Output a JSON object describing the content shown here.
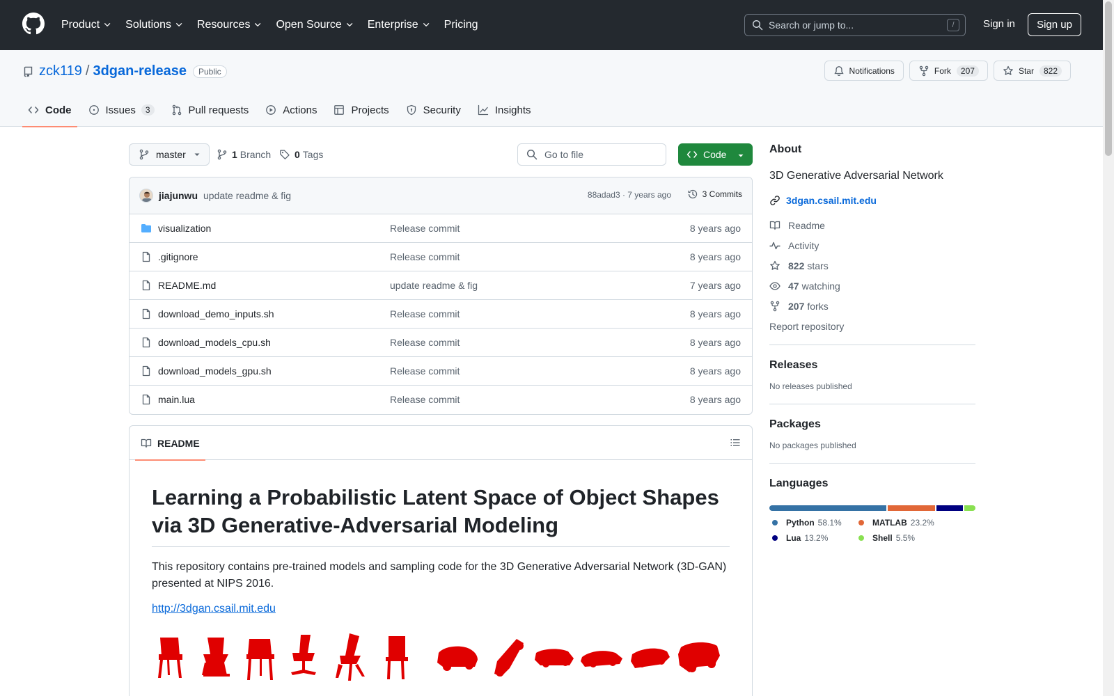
{
  "header": {
    "nav": [
      {
        "label": "Product",
        "has_menu": true
      },
      {
        "label": "Solutions",
        "has_menu": true
      },
      {
        "label": "Resources",
        "has_menu": true
      },
      {
        "label": "Open Source",
        "has_menu": true
      },
      {
        "label": "Enterprise",
        "has_menu": true
      },
      {
        "label": "Pricing",
        "has_menu": false
      }
    ],
    "search_placeholder": "Search or jump to...",
    "search_shortcut": "/",
    "sign_in": "Sign in",
    "sign_up": "Sign up"
  },
  "repo": {
    "owner": "zck119",
    "separator": "/",
    "name": "3dgan-release",
    "visibility": "Public",
    "notifications_label": "Notifications",
    "fork_label": "Fork",
    "fork_count": "207",
    "star_label": "Star",
    "star_count": "822"
  },
  "tabs": [
    {
      "label": "Code",
      "icon": "code-icon",
      "active": true,
      "counter": ""
    },
    {
      "label": "Issues",
      "icon": "issue-icon",
      "active": false,
      "counter": "3"
    },
    {
      "label": "Pull requests",
      "icon": "pull-request-icon",
      "active": false,
      "counter": ""
    },
    {
      "label": "Actions",
      "icon": "play-icon",
      "active": false,
      "counter": ""
    },
    {
      "label": "Projects",
      "icon": "table-icon",
      "active": false,
      "counter": ""
    },
    {
      "label": "Security",
      "icon": "shield-icon",
      "active": false,
      "counter": ""
    },
    {
      "label": "Insights",
      "icon": "graph-icon",
      "active": false,
      "counter": ""
    }
  ],
  "toolbar": {
    "branch": "master",
    "branch_count": "1",
    "branch_label": "Branch",
    "tag_count": "0",
    "tag_label": "Tags",
    "goto_placeholder": "Go to file",
    "code_button": "Code"
  },
  "latest_commit": {
    "author": "jiajunwu",
    "message": "update readme & fig",
    "meta": "88adad3 · 7 years ago",
    "commits": "3 Commits"
  },
  "files": [
    {
      "name": "visualization",
      "type": "folder",
      "message": "Release commit",
      "age": "8 years ago"
    },
    {
      "name": ".gitignore",
      "type": "file",
      "message": "Release commit",
      "age": "8 years ago"
    },
    {
      "name": "README.md",
      "type": "file",
      "message": "update readme & fig",
      "age": "7 years ago"
    },
    {
      "name": "download_demo_inputs.sh",
      "type": "file",
      "message": "Release commit",
      "age": "8 years ago"
    },
    {
      "name": "download_models_cpu.sh",
      "type": "file",
      "message": "Release commit",
      "age": "8 years ago"
    },
    {
      "name": "download_models_gpu.sh",
      "type": "file",
      "message": "Release commit",
      "age": "8 years ago"
    },
    {
      "name": "main.lua",
      "type": "file",
      "message": "Release commit",
      "age": "8 years ago"
    }
  ],
  "readme": {
    "tab_label": "README",
    "title": "Learning a Probabilistic Latent Space of Object Shapes via 3D Generative-Adversarial Modeling",
    "paragraph": "This repository contains pre-trained models and sampling code for the 3D Generative Adversarial Network (3D-GAN) presented at NIPS 2016.",
    "link": "http://3dgan.csail.mit.edu"
  },
  "about": {
    "heading": "About",
    "description": "3D Generative Adversarial Network",
    "homepage": "3dgan.csail.mit.edu",
    "readme": "Readme",
    "activity": "Activity",
    "stars_count": "822",
    "stars_label": "stars",
    "watching_count": "47",
    "watching_label": "watching",
    "forks_count": "207",
    "forks_label": "forks",
    "report": "Report repository"
  },
  "releases": {
    "heading": "Releases",
    "empty": "No releases published"
  },
  "packages": {
    "heading": "Packages",
    "empty": "No packages published"
  },
  "languages": {
    "heading": "Languages",
    "items": [
      {
        "name": "Python",
        "percent": 58.1,
        "label": "58.1%",
        "color": "#3572A5"
      },
      {
        "name": "MATLAB",
        "percent": 23.2,
        "label": "23.2%",
        "color": "#e16737"
      },
      {
        "name": "Lua",
        "percent": 13.2,
        "label": "13.2%",
        "color": "#000080"
      },
      {
        "name": "Shell",
        "percent": 5.5,
        "label": "5.5%",
        "color": "#89e051"
      }
    ]
  }
}
